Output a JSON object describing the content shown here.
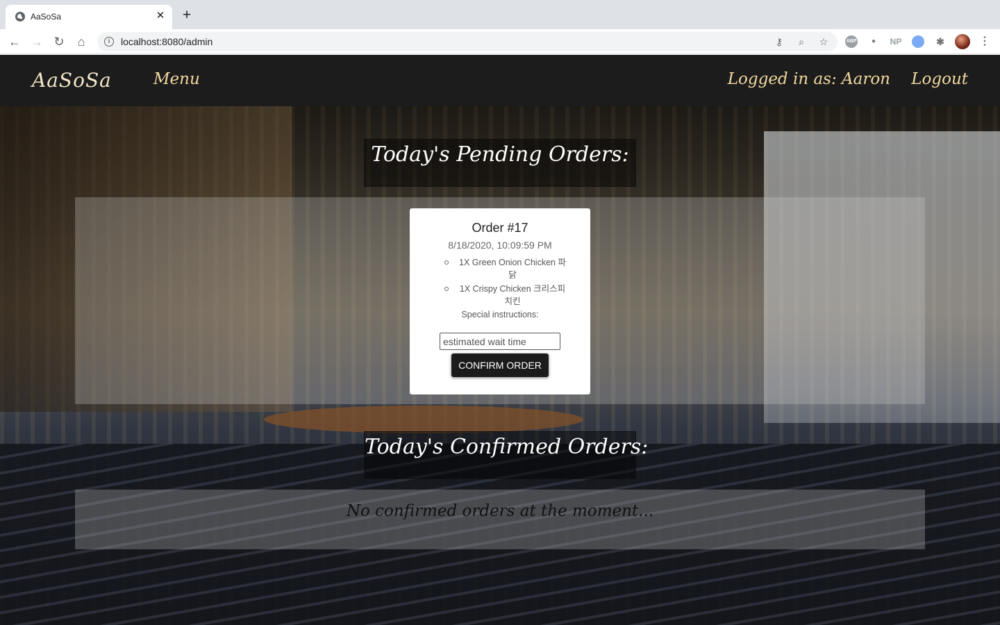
{
  "browser": {
    "tab_title": "AaSoSa",
    "url_host": "localhost:8080/admin",
    "close_glyph": "✕",
    "newtab_glyph": "+",
    "ext_abp": "ABP",
    "ext_np": "NP"
  },
  "nav": {
    "brand": "AaSoSa",
    "menu": "Menu",
    "logged_in": "Logged in as: Aaron",
    "logout": "Logout"
  },
  "pending": {
    "heading": "Today's Pending Orders:",
    "orders": [
      {
        "title": "Order #17",
        "date": "8/18/2020, 10:09:59 PM",
        "items": [
          "1X Green Onion Chicken 파닭",
          "1X Crispy Chicken 크리스피 치킨"
        ],
        "special_label": "Special instructions:",
        "wait_placeholder": "estimated wait time",
        "confirm_label": "CONFIRM ORDER"
      }
    ]
  },
  "confirmed": {
    "heading": "Today's Confirmed Orders:",
    "empty_message": "No confirmed orders at the moment..."
  }
}
